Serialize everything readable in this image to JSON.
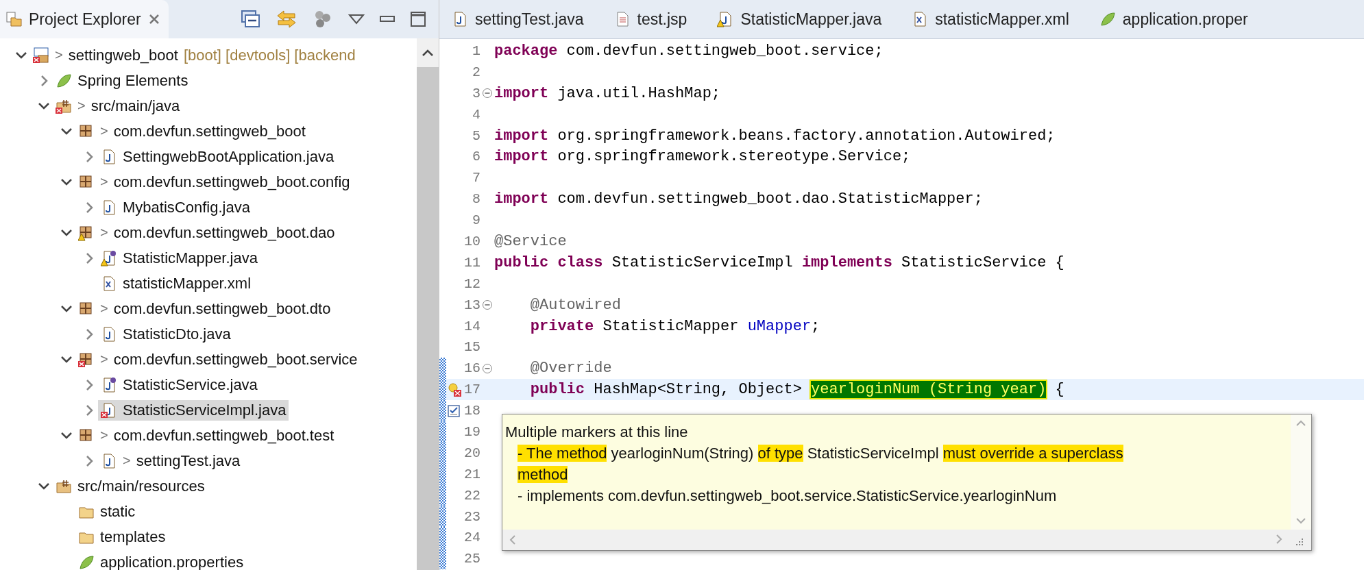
{
  "explorer": {
    "title": "Project Explorer",
    "tree": [
      {
        "label": "settingweb_boot",
        "prefix": ">",
        "decorations": "[boot] [devtools] [backend",
        "expanded": true,
        "kind": "project",
        "error": true,
        "warning": false,
        "selected": false,
        "children": [
          {
            "label": "Spring Elements",
            "expanded": false,
            "kind": "spring",
            "error": false,
            "warning": false,
            "selected": false
          },
          {
            "label": "src/main/java",
            "prefix": ">",
            "expanded": true,
            "kind": "srcfolder",
            "error": true,
            "warning": false,
            "selected": false,
            "children": [
              {
                "label": "com.devfun.settingweb_boot",
                "prefix": ">",
                "expanded": true,
                "kind": "package",
                "error": false,
                "warning": false,
                "selected": false,
                "children": [
                  {
                    "label": "SettingwebBootApplication.java",
                    "expanded": false,
                    "kind": "java",
                    "error": false,
                    "warning": false,
                    "selected": false
                  }
                ]
              },
              {
                "label": "com.devfun.settingweb_boot.config",
                "prefix": ">",
                "expanded": true,
                "kind": "package",
                "error": false,
                "warning": false,
                "selected": false,
                "children": [
                  {
                    "label": "MybatisConfig.java",
                    "expanded": false,
                    "kind": "java",
                    "error": false,
                    "warning": false,
                    "selected": false
                  }
                ]
              },
              {
                "label": "com.devfun.settingweb_boot.dao",
                "prefix": ">",
                "expanded": true,
                "kind": "package",
                "error": false,
                "warning": true,
                "selected": false,
                "children": [
                  {
                    "label": "StatisticMapper.java",
                    "expanded": false,
                    "kind": "interface",
                    "error": false,
                    "warning": true,
                    "selected": false
                  },
                  {
                    "label": "statisticMapper.xml",
                    "kind": "xml",
                    "error": false,
                    "warning": false,
                    "selected": false
                  }
                ]
              },
              {
                "label": "com.devfun.settingweb_boot.dto",
                "prefix": ">",
                "expanded": true,
                "kind": "package",
                "error": false,
                "warning": false,
                "selected": false,
                "children": [
                  {
                    "label": "StatisticDto.java",
                    "expanded": false,
                    "kind": "java",
                    "error": false,
                    "warning": false,
                    "selected": false
                  }
                ]
              },
              {
                "label": "com.devfun.settingweb_boot.service",
                "prefix": ">",
                "expanded": true,
                "kind": "package",
                "error": true,
                "warning": false,
                "selected": false,
                "children": [
                  {
                    "label": "StatisticService.java",
                    "expanded": false,
                    "kind": "interface",
                    "error": false,
                    "warning": false,
                    "selected": false
                  },
                  {
                    "label": "StatisticServiceImpl.java",
                    "expanded": false,
                    "kind": "java",
                    "error": true,
                    "warning": false,
                    "selected": true
                  }
                ]
              },
              {
                "label": "com.devfun.settingweb_boot.test",
                "prefix": ">",
                "expanded": true,
                "kind": "package",
                "error": false,
                "warning": false,
                "selected": false,
                "children": [
                  {
                    "label": "settingTest.java",
                    "prefix": ">",
                    "expanded": false,
                    "kind": "java",
                    "error": false,
                    "warning": false,
                    "selected": false
                  }
                ]
              }
            ]
          },
          {
            "label": "src/main/resources",
            "expanded": true,
            "kind": "resfolder",
            "error": false,
            "warning": false,
            "selected": false,
            "children": [
              {
                "label": "static",
                "kind": "folder",
                "error": false,
                "warning": false,
                "selected": false
              },
              {
                "label": "templates",
                "kind": "folder",
                "error": false,
                "warning": false,
                "selected": false
              },
              {
                "label": "application.properties",
                "kind": "spring",
                "error": false,
                "warning": false,
                "selected": false
              }
            ]
          }
        ]
      }
    ]
  },
  "editor_tabs": [
    {
      "label": "settingTest.java",
      "kind": "java"
    },
    {
      "label": "test.jsp",
      "kind": "jsp"
    },
    {
      "label": "StatisticMapper.java",
      "kind": "javawarn"
    },
    {
      "label": "statisticMapper.xml",
      "kind": "xml"
    },
    {
      "label": "application.proper",
      "kind": "spring"
    }
  ],
  "code_lines": [
    {
      "number": "1",
      "segments": [
        {
          "kind": "keyword",
          "text": "package"
        },
        {
          "kind": "plain",
          "text": " com.devfun.settingweb_boot.service;"
        }
      ]
    },
    {
      "number": "2"
    },
    {
      "number": "3",
      "fold": true,
      "segments": [
        {
          "kind": "keyword",
          "text": "import"
        },
        {
          "kind": "plain",
          "text": " java.util.HashMap;"
        }
      ]
    },
    {
      "number": "4"
    },
    {
      "number": "5",
      "segments": [
        {
          "kind": "keyword",
          "text": "import"
        },
        {
          "kind": "plain",
          "text": " org.springframework.beans.factory.annotation.Autowired;"
        }
      ]
    },
    {
      "number": "6",
      "segments": [
        {
          "kind": "keyword",
          "text": "import"
        },
        {
          "kind": "plain",
          "text": " org.springframework.stereotype.Service;"
        }
      ]
    },
    {
      "number": "7"
    },
    {
      "number": "8",
      "segments": [
        {
          "kind": "keyword",
          "text": "import"
        },
        {
          "kind": "plain",
          "text": " com.devfun.settingweb_boot.dao.StatisticMapper;"
        }
      ]
    },
    {
      "number": "9"
    },
    {
      "number": "10",
      "segments": [
        {
          "kind": "annotation",
          "text": "@Service"
        }
      ]
    },
    {
      "number": "11",
      "segments": [
        {
          "kind": "keyword",
          "text": "public class"
        },
        {
          "kind": "plain",
          "text": " StatisticServiceImpl "
        },
        {
          "kind": "keyword",
          "text": "implements"
        },
        {
          "kind": "plain",
          "text": " StatisticService {"
        }
      ]
    },
    {
      "number": "12"
    },
    {
      "number": "13",
      "fold": true,
      "segments": [
        {
          "kind": "annotation",
          "text": "    @Autowired"
        }
      ]
    },
    {
      "number": "14",
      "segments": [
        {
          "kind": "keyword",
          "text": "    private"
        },
        {
          "kind": "plain",
          "text": " StatisticMapper "
        },
        {
          "kind": "field",
          "text": "uMapper"
        },
        {
          "kind": "plain",
          "text": ";"
        }
      ]
    },
    {
      "number": "15"
    },
    {
      "number": "16",
      "fold": true,
      "changed": true,
      "segments": [
        {
          "kind": "annotation",
          "text": "    @Override"
        }
      ]
    },
    {
      "number": "17",
      "changed": true,
      "current": true,
      "kind": "error",
      "segments": [
        {
          "kind": "keyword",
          "text": "    public"
        },
        {
          "kind": "plain",
          "text": " HashMap<String, Object> "
        },
        {
          "kind": "highlight",
          "text": "yearloginNum (String year)"
        },
        {
          "kind": "plain",
          "text": " {"
        }
      ]
    },
    {
      "number": "18",
      "changed": true,
      "kind": "task"
    },
    {
      "number": "19",
      "changed": true
    },
    {
      "number": "20",
      "changed": true
    },
    {
      "number": "21",
      "changed": true
    },
    {
      "number": "22",
      "changed": true
    },
    {
      "number": "23",
      "changed": true
    },
    {
      "number": "24",
      "changed": true
    },
    {
      "number": "25",
      "changed": true
    }
  ],
  "hover_popup": {
    "title": "Multiple markers at this line",
    "items": [
      {
        "segments": [
          {
            "text": "- The method",
            "highlighted": true
          },
          {
            "text": " yearloginNum(String) ",
            "highlighted": false
          },
          {
            "text": "of type",
            "highlighted": true
          },
          {
            "text": " StatisticServiceImpl ",
            "highlighted": false
          },
          {
            "text": "must override a superclass method",
            "highlighted": true
          }
        ]
      },
      {
        "segments": [
          {
            "text": "- implements com.devfun.settingweb_boot.service.StatisticService.yearloginNum",
            "highlighted": false
          }
        ]
      }
    ]
  }
}
